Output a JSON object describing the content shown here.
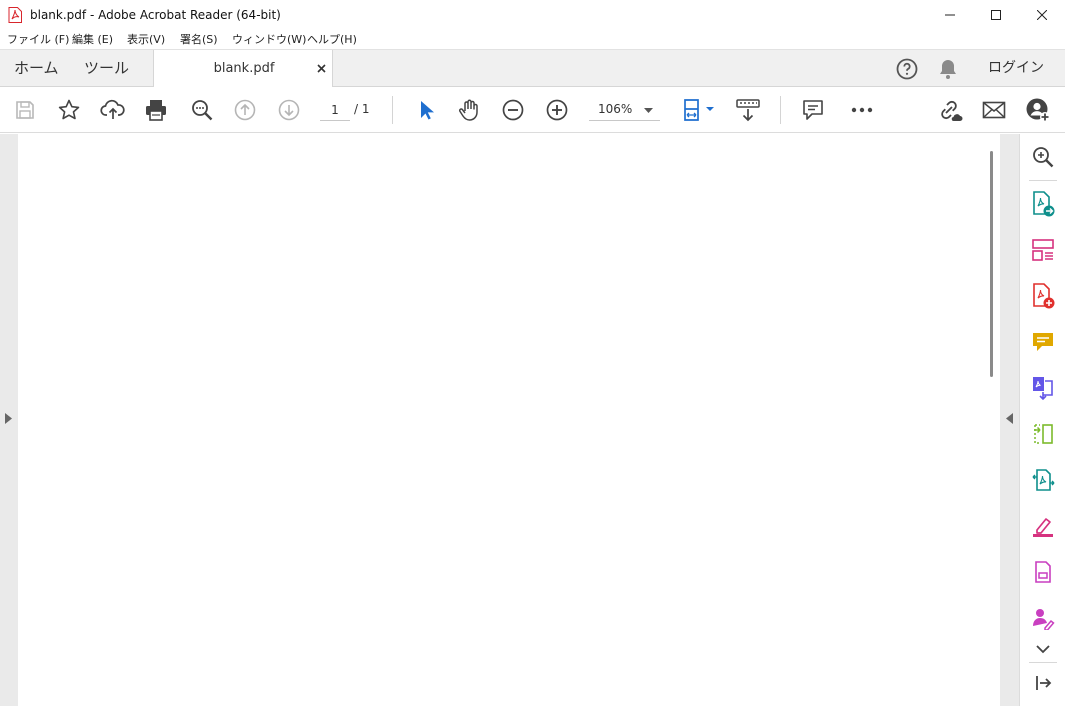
{
  "window": {
    "title": "blank.pdf - Adobe Acrobat Reader (64-bit)",
    "app_icon": "acrobat-icon",
    "controls": [
      "minimize-icon",
      "maximize-icon",
      "close-icon"
    ]
  },
  "menubar": {
    "items": [
      {
        "label": "ファイル (F)"
      },
      {
        "label": "編集 (E)"
      },
      {
        "label": "表示(V)"
      },
      {
        "label": "署名(S)"
      },
      {
        "label": "ウィンドウ(W)"
      },
      {
        "label": "ヘルプ(H)"
      }
    ]
  },
  "tabs": {
    "home": "ホーム",
    "tools": "ツール",
    "document": "blank.pdf",
    "login": "ログイン"
  },
  "toolbar": {
    "current_page": "1",
    "page_total": "/ 1",
    "zoom": "106%"
  },
  "colors": {
    "accent_blue": "#1f6fcf",
    "export_teal": "#0e8f8c",
    "organize_pink": "#d6327f",
    "create_red": "#e0302d",
    "comment_yellow": "#e0a800",
    "combine_purple": "#6356e8",
    "compress_green": "#7cbb2c",
    "sign_magenta": "#c93fc0"
  }
}
